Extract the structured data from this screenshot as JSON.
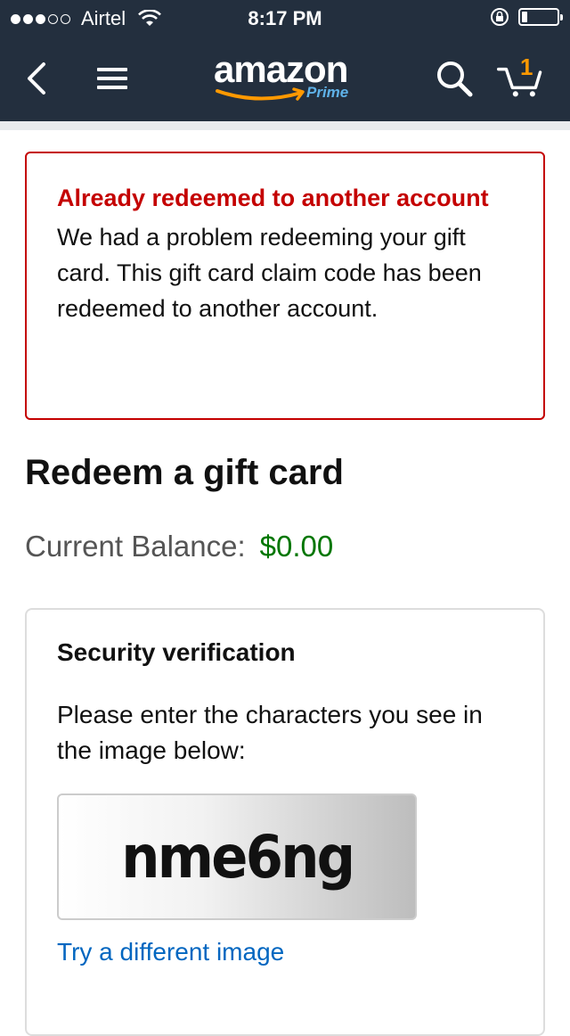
{
  "status_bar": {
    "signal_dots_filled": 3,
    "signal_dots_total": 5,
    "carrier": "Airtel",
    "time": "8:17 PM",
    "battery_level": 0.15
  },
  "nav": {
    "logo_text": "amazon",
    "logo_sub": "Prime",
    "cart_count": "1"
  },
  "alert": {
    "title": "Already redeemed to another account",
    "message": "We had a problem redeeming your gift card. This gift card claim code has been redeemed to another account."
  },
  "page": {
    "title": "Redeem a gift card",
    "balance_label": "Current Balance:",
    "balance_value": "$0.00"
  },
  "security": {
    "title": "Security verification",
    "instruction": "Please enter the characters you see in the image below:",
    "captcha_text": "nme6ng",
    "try_link": "Try a different image"
  },
  "colors": {
    "nav_bg": "#232f3e",
    "alert_red": "#c40000",
    "balance_green": "#007600",
    "link_blue": "#0066c0",
    "amazon_orange": "#ff9900"
  }
}
